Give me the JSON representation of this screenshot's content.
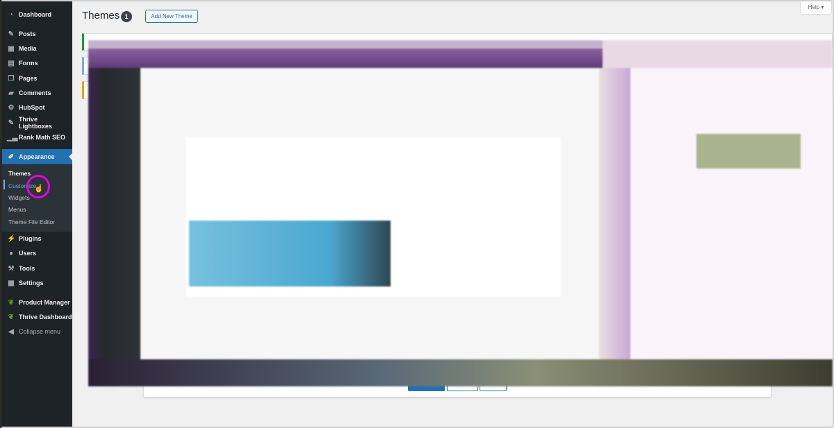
{
  "sidebar": {
    "items": [
      {
        "label": "Dashboard",
        "icon": "dashboard-icon"
      },
      {
        "label": "Posts",
        "icon": "pin-icon"
      },
      {
        "label": "Media",
        "icon": "media-icon"
      },
      {
        "label": "Forms",
        "icon": "forms-icon"
      },
      {
        "label": "Pages",
        "icon": "pages-icon"
      },
      {
        "label": "Comments",
        "icon": "comment-icon"
      },
      {
        "label": "HubSpot",
        "icon": "hubspot-icon"
      },
      {
        "label": "Thrive Lightboxes",
        "icon": "pin-icon"
      },
      {
        "label": "Rank Math SEO",
        "icon": "chart-icon"
      },
      {
        "label": "Appearance",
        "icon": "brush-icon"
      },
      {
        "label": "Plugins",
        "icon": "plugin-icon"
      },
      {
        "label": "Users",
        "icon": "user-icon"
      },
      {
        "label": "Tools",
        "icon": "wrench-icon"
      },
      {
        "label": "Settings",
        "icon": "settings-icon"
      },
      {
        "label": "Product Manager",
        "icon": "leaf-icon"
      },
      {
        "label": "Thrive Dashboard",
        "icon": "leaf-icon"
      },
      {
        "label": "Collapse menu",
        "icon": "collapse-icon"
      }
    ],
    "submenu": [
      "Themes",
      "Customize",
      "Widgets",
      "Menus",
      "Theme File Editor"
    ]
  },
  "header": {
    "title": "Themes",
    "count": "1",
    "add_new": "Add New Theme",
    "help": "Help ▾"
  },
  "colors": {
    "accent": "#2271b1",
    "sidebar": "#1d2327",
    "highlight_ring": "#e600e6"
  }
}
